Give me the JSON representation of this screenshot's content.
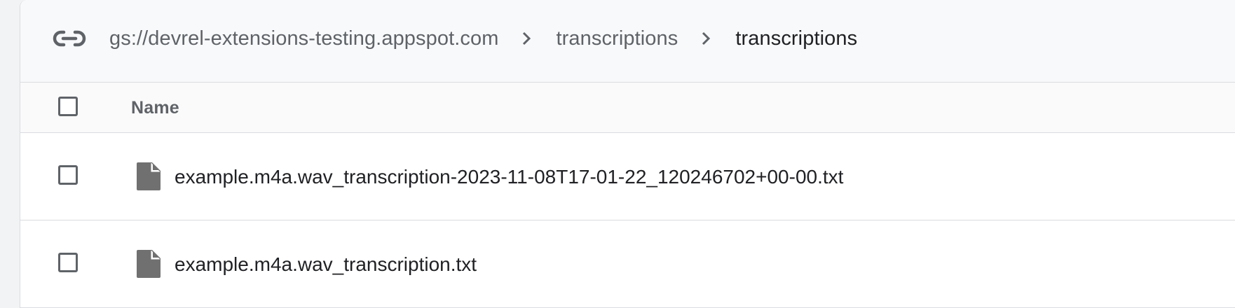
{
  "breadcrumb": {
    "items": [
      {
        "label": "gs://devrel-extensions-testing.appspot.com"
      },
      {
        "label": "transcriptions"
      },
      {
        "label": "transcriptions"
      }
    ],
    "icon": "link-icon",
    "separator_icon": "chevron-right-icon"
  },
  "table": {
    "columns": [
      {
        "label": "Name"
      }
    ],
    "rows": [
      {
        "name": "example.m4a.wav_transcription-2023-11-08T17-01-22_120246702+00-00.txt",
        "icon": "file-icon"
      },
      {
        "name": "example.m4a.wav_transcription.txt",
        "icon": "file-icon"
      }
    ]
  },
  "colors": {
    "text_primary": "#202124",
    "text_secondary": "#5f6368",
    "divider": "#dadce0",
    "icon_fill": "#707070"
  }
}
